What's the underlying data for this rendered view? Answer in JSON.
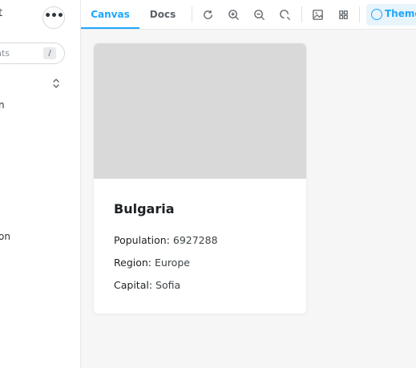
{
  "sidebar": {
    "brand_fragment": "t",
    "search_placeholder": "nts",
    "search_shortcut": "/",
    "items": [
      {
        "label": "n"
      },
      {
        "label": "on"
      }
    ]
  },
  "toolbar": {
    "tabs": [
      {
        "label": "Canvas",
        "active": true
      },
      {
        "label": "Docs",
        "active": false
      }
    ],
    "tools": [
      "reload-icon",
      "zoom-in-icon",
      "zoom-out-icon",
      "zoom-reset-icon",
      "background-icon",
      "grid-icon"
    ],
    "theme_label": "Theme"
  },
  "card": {
    "country": "Bulgaria",
    "population_label": "Population:",
    "population_value": "6927288",
    "region_label": "Region:",
    "region_value": "Europe",
    "capital_label": "Capital:",
    "capital_value": "Sofia"
  },
  "colors": {
    "accent": "#1ea7fd",
    "image_placeholder": "#d9d9da",
    "canvas_bg": "#f6f6f7"
  }
}
